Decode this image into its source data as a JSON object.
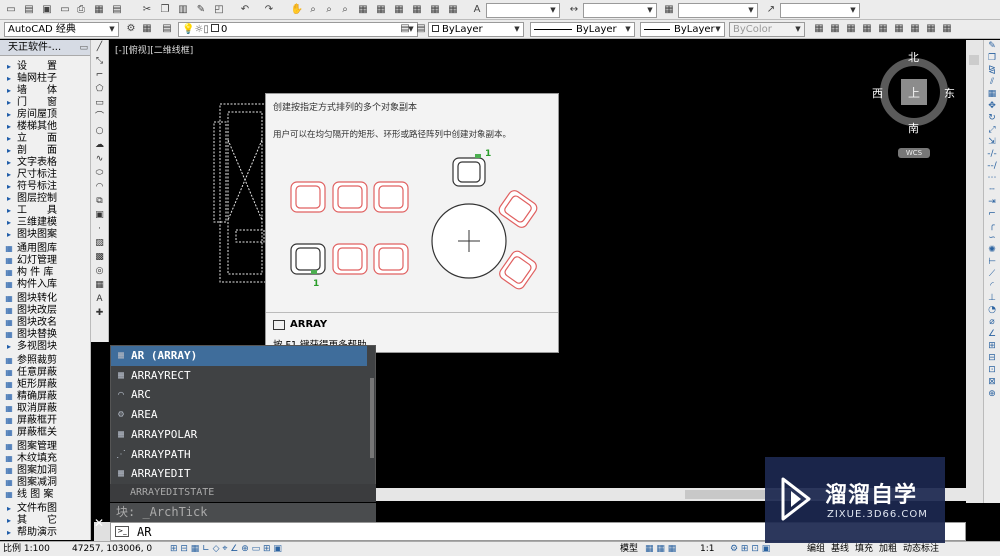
{
  "toolbar1": {
    "icons": [
      "new-icon",
      "open-icon",
      "save-icon",
      "print-icon",
      "cut-icon",
      "copy-icon",
      "paste-icon",
      "match-icon",
      "undo-icon",
      "redo-icon",
      "pan-icon",
      "zoom-icon",
      "properties-icon",
      "layer-icon",
      "text-style-icon"
    ],
    "text_style_value": "",
    "dim_style_value": ""
  },
  "toolbar2": {
    "workspace": "AutoCAD 经典",
    "layer_value": "0",
    "color": "ByLayer",
    "linetype": "ByLayer",
    "lineweight": "ByLayer",
    "plotstyle": "ByColor"
  },
  "left_panel": {
    "title": "天正软件-...",
    "items": [
      "设　　置",
      "轴网柱子",
      "墙　　体",
      "门　　窗",
      "房间屋顶",
      "楼梯其他",
      "立　　面",
      "剖　　面",
      "文字表格",
      "尺寸标注",
      "符号标注",
      "图层控制",
      "工　　具",
      "三维建模",
      "图块图案",
      "通用图库",
      "幻灯管理",
      "构 件 库",
      "构件入库",
      "图块转化",
      "图块改层",
      "图块改名",
      "图块替换",
      "多视图块",
      "参照裁剪",
      "任意屏蔽",
      "矩形屏蔽",
      "精确屏蔽",
      "取消屏蔽",
      "屏蔽框开",
      "屏蔽框关",
      "图案管理",
      "木纹填充",
      "图案加洞",
      "图案减洞",
      "线 图 案",
      "文件布图",
      "其　　它",
      "帮助演示"
    ]
  },
  "viewport_label": "[-][俯视][二维线框]",
  "compass": {
    "north": "北",
    "south": "南",
    "east": "东",
    "west": "西",
    "center": "上",
    "wcs": "WCS"
  },
  "tooltip": {
    "title": "创建按指定方式排列的多个对象副本",
    "description": "用户可以在均匀隔开的矩形、环形或路径阵列中创建对象副本。",
    "label_one_a": "1",
    "label_one_b": "1",
    "command": "ARRAY",
    "help": "按 F1 键获得更多帮助"
  },
  "autocomplete": {
    "items": [
      {
        "label": "AR (ARRAY)",
        "icon": "array-icon"
      },
      {
        "label": "ARRAYRECT",
        "icon": "array-rect-icon"
      },
      {
        "label": "ARC",
        "icon": "arc-icon"
      },
      {
        "label": "AREA",
        "icon": "area-icon"
      },
      {
        "label": "ARRAYPOLAR",
        "icon": "array-polar-icon"
      },
      {
        "label": "ARRAYPATH",
        "icon": "array-path-icon"
      },
      {
        "label": "ARRAYEDIT",
        "icon": "array-edit-icon"
      },
      {
        "label": "ARRAYEDITSTATE",
        "icon": "gear-icon"
      }
    ]
  },
  "history_line": "块: _ArchTick",
  "command_input": "AR",
  "status": {
    "scale": "比例 1:100",
    "coords": "47257, 103006, 0",
    "model": "模型",
    "annot_scale": "1:1",
    "buttons": [
      "编组",
      "基线",
      "填充",
      "加粗",
      "动态标注"
    ]
  },
  "watermark": {
    "main": "溜溜自学",
    "sub": "ZIXUE.3D66.COM"
  }
}
